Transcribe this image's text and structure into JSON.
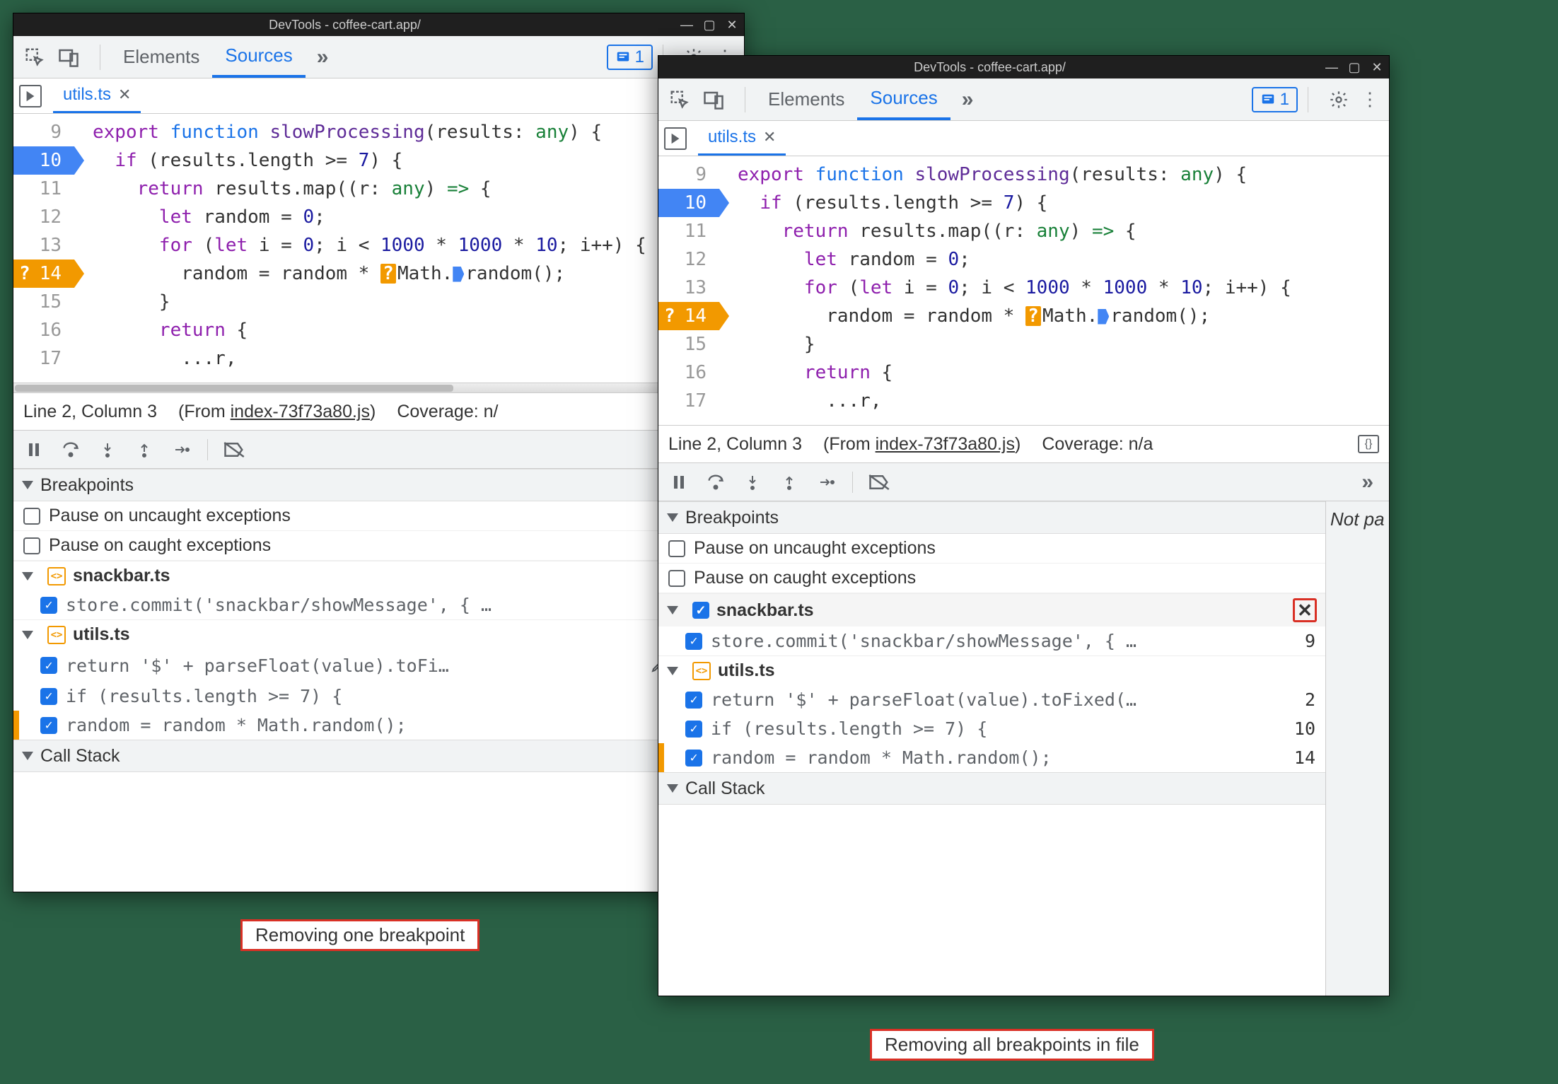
{
  "window_title": "DevTools - coffee-cart.app/",
  "tabs": {
    "elements": "Elements",
    "sources": "Sources",
    "more": "»"
  },
  "issues_count": "1",
  "file_tab": "utils.ts",
  "code": {
    "lines": [
      {
        "n": "9",
        "bp": "",
        "html": "<span class='tok-kw'>export</span> <span class='tok-fn'>function</span> <span class='tok-name'>slowProcessing</span>(results: <span class='tok-type'>any</span>) {"
      },
      {
        "n": "10",
        "bp": "bp-blue",
        "html": "  <span class='tok-kw'>if</span> (results.length &gt;= <span class='tok-num'>7</span>) {"
      },
      {
        "n": "11",
        "bp": "",
        "html": "    <span class='tok-kw'>return</span> results.map((r: <span class='tok-type'>any</span>) <span class='tok-op'>=&gt;</span> {"
      },
      {
        "n": "12",
        "bp": "",
        "html": "      <span class='tok-kw'>let</span> random = <span class='tok-num'>0</span>;"
      },
      {
        "n": "13",
        "bp": "",
        "html": "      <span class='tok-kw'>for</span> (<span class='tok-kw'>let</span> i = <span class='tok-num'>0</span>; i &lt; <span class='tok-num'>1000</span> * <span class='tok-num'>1000</span> * <span class='tok-num'>10</span>; i++) {"
      },
      {
        "n": "14",
        "bp": "bp-orange",
        "html": "        random = random * <span class='inline-bp-q'>?</span>Math.<span class='inline-bp-b'></span>random();",
        "q": "?"
      },
      {
        "n": "15",
        "bp": "",
        "html": "      }"
      },
      {
        "n": "16",
        "bp": "",
        "html": "      <span class='tok-kw'>return</span> {"
      },
      {
        "n": "17",
        "bp": "",
        "html": "        ...r,"
      }
    ]
  },
  "status": {
    "pos": "Line 2, Column 3",
    "from_prefix": "(From ",
    "from_file": "index-73f73a80.js",
    "from_suffix": ")",
    "coverage_short": "Coverage: n/",
    "coverage_full": "Coverage: n/a"
  },
  "sections": {
    "breakpoints": "Breakpoints",
    "call_stack": "Call Stack"
  },
  "pause_opts": {
    "uncaught": "Pause on uncaught exceptions",
    "caught": "Pause on caught exceptions"
  },
  "bp_groups": [
    {
      "file": "snackbar.ts",
      "items": [
        {
          "code": "store.commit('snackbar/showMessage', { …",
          "line": "9"
        }
      ]
    },
    {
      "file": "utils.ts",
      "items": [
        {
          "code_short": "return '$' + parseFloat(value).toFi…",
          "code_long": "return '$' + parseFloat(value).toFixed(…",
          "line": "2"
        },
        {
          "code": "if (results.length >= 7) {",
          "line": "10"
        },
        {
          "code": "random = random * Math.random();",
          "line": "14"
        }
      ]
    }
  ],
  "right_panel": "Not pa",
  "captions": {
    "left": "Removing one breakpoint",
    "right": "Removing all breakpoints in file"
  }
}
